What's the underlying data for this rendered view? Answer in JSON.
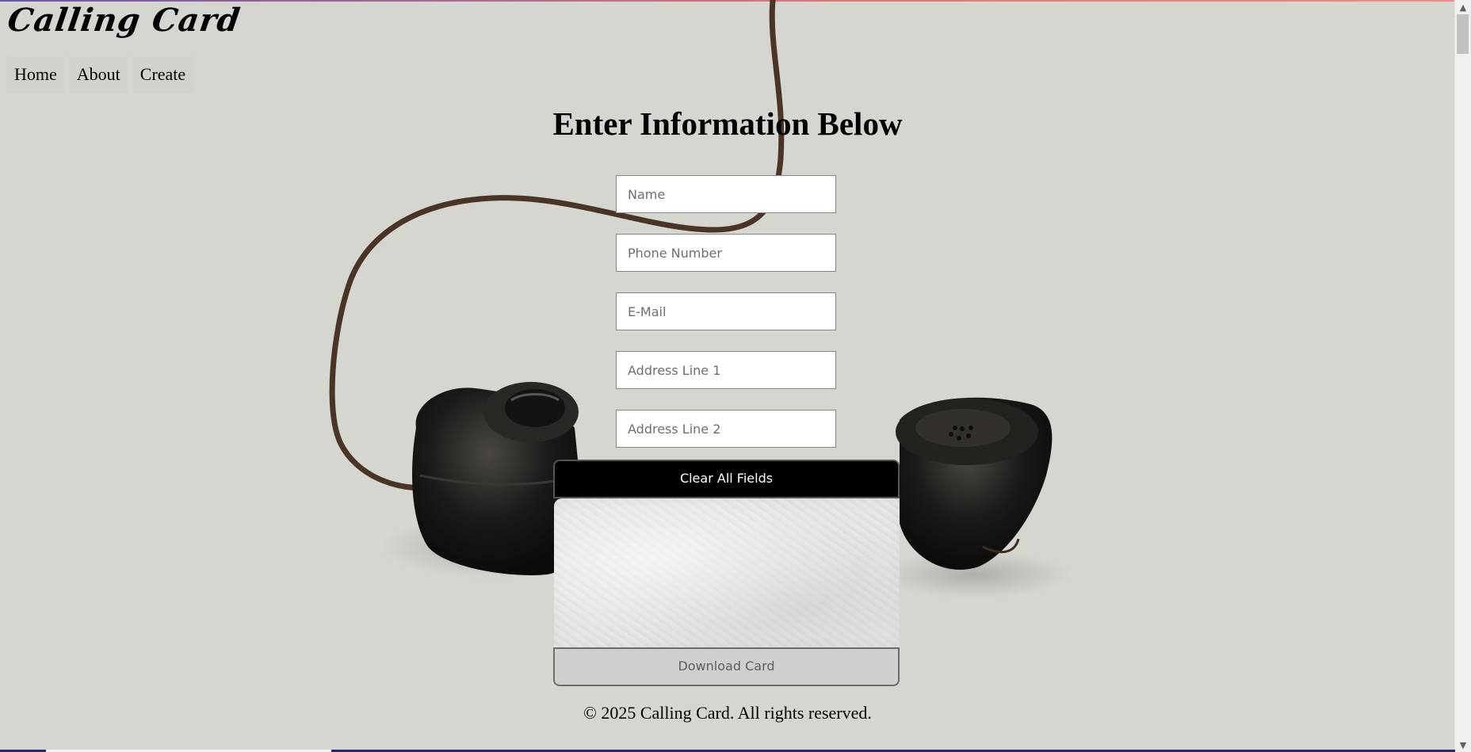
{
  "app": {
    "brand": "Calling Card"
  },
  "nav": {
    "items": [
      {
        "label": "Home"
      },
      {
        "label": "About"
      },
      {
        "label": "Create"
      }
    ]
  },
  "form": {
    "heading": "Enter Information Below",
    "fields": [
      {
        "placeholder": "Name",
        "value": ""
      },
      {
        "placeholder": "Phone Number",
        "value": ""
      },
      {
        "placeholder": "E-Mail",
        "value": ""
      },
      {
        "placeholder": "Address Line 1",
        "value": ""
      },
      {
        "placeholder": "Address Line 2",
        "value": ""
      }
    ],
    "clear_label": "Clear All Fields",
    "download_label": "Download Card"
  },
  "footer": {
    "text": "© 2025 Calling Card. All rights reserved."
  },
  "colors": {
    "background": "#d6d6d0",
    "clear_button_bg": "#000000",
    "download_button_bg": "#cfcfcf"
  },
  "icons": {
    "scroll_up": "chevron-up-icon",
    "scroll_down": "chevron-down-icon",
    "background_image": "telephone-handset-image"
  }
}
